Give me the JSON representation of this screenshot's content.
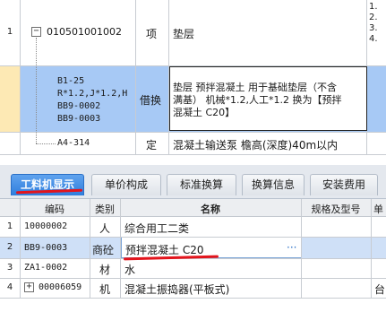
{
  "top_grid": {
    "rows": [
      {
        "num": "1",
        "code": "010501001002",
        "category": "项",
        "name": "垫层",
        "right_clipped": [
          "1.",
          "2.",
          "3.",
          "4."
        ]
      },
      {
        "num": "",
        "code_lines": [
          "B1-25",
          "R*1.2,J*1.2,H",
          "BB9-0002",
          "BB9-0003"
        ],
        "category": "借换",
        "name_lines": [
          "垫层 预拌混凝土 用于基础垫层（不含",
          "满基） 机械*1.2,人工*1.2 换为【预拌",
          "混凝土 C20】"
        ]
      },
      {
        "num": "",
        "code": "A4-314",
        "category": "定",
        "name": "混凝土输送泵 檐高(深度)40m以内"
      }
    ]
  },
  "tabs": [
    {
      "label": "工料机显示",
      "active": true
    },
    {
      "label": "单价构成",
      "active": false
    },
    {
      "label": "标准换算",
      "active": false
    },
    {
      "label": "换算信息",
      "active": false
    },
    {
      "label": "安装费用",
      "active": false
    }
  ],
  "bottom_grid": {
    "headers": {
      "code": "编码",
      "type": "类别",
      "name": "名称",
      "spec": "规格及型号",
      "unit": "单"
    },
    "rows": [
      {
        "num": "1",
        "code": "10000002",
        "type": "人",
        "name": "综合用工二类",
        "unit": ""
      },
      {
        "num": "2",
        "code": "BB9-0003",
        "type": "商砼",
        "name": "预拌混凝土 C20",
        "ellipsis": "···",
        "unit": ""
      },
      {
        "num": "3",
        "code": "ZA1-0002",
        "type": "材",
        "name": "水",
        "unit": ""
      },
      {
        "num": "4",
        "expand": "+",
        "code": "00006059",
        "type": "机",
        "name": "混凝土振捣器(平板式)",
        "unit": "台"
      }
    ]
  },
  "colors": {
    "selected_row": "#a7c9f5",
    "tab_active": "#3c88e6",
    "annotation": "#e3141c"
  }
}
